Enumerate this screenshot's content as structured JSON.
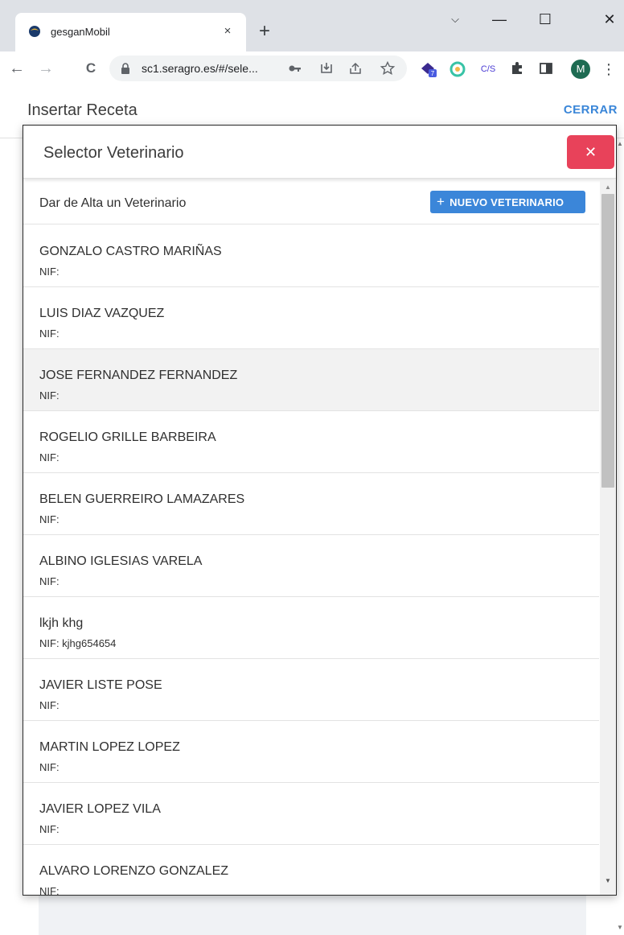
{
  "browser": {
    "tab_title": "gesganMobil",
    "tab_close": "×",
    "new_tab": "+",
    "url": "sc1.seragro.es/#/sele...",
    "back": "←",
    "forward": "→",
    "reload": "C",
    "window_minimize": "—",
    "window_maximize": "☐",
    "window_close": "✕",
    "window_dropdown": "⌵",
    "ext_badge": "7",
    "ext_cs": "C/S",
    "profile_initial": "M",
    "menu": "⋮"
  },
  "app": {
    "title": "Insertar Receta",
    "close_label": "CERRAR"
  },
  "modal": {
    "title": "Selector Veterinario",
    "close_icon": "✕",
    "add_label": "Dar de Alta un Veterinario",
    "new_button_icon": "+",
    "new_button_label": "NUEVO VETERINARIO",
    "veterinarians": [
      {
        "name": "GONZALO CASTRO MARIÑAS",
        "nif": "NIF:"
      },
      {
        "name": "LUIS DIAZ VAZQUEZ",
        "nif": "NIF:"
      },
      {
        "name": "JOSE FERNANDEZ FERNANDEZ",
        "nif": "NIF:",
        "highlighted": true
      },
      {
        "name": "ROGELIO GRILLE BARBEIRA",
        "nif": "NIF:"
      },
      {
        "name": "BELEN GUERREIRO LAMAZARES",
        "nif": "NIF:"
      },
      {
        "name": "ALBINO IGLESIAS VARELA",
        "nif": "NIF:"
      },
      {
        "name": "lkjh khg",
        "nif": "NIF: kjhg654654"
      },
      {
        "name": "JAVIER LISTE POSE",
        "nif": "NIF:"
      },
      {
        "name": "MARTIN LOPEZ LOPEZ",
        "nif": "NIF:"
      },
      {
        "name": "JAVIER LOPEZ VILA",
        "nif": "NIF:"
      },
      {
        "name": "ALVARO LORENZO GONZALEZ",
        "nif": "NIF:"
      }
    ]
  },
  "colors": {
    "accent": "#3b86d9",
    "close_button": "#e8425a",
    "highlight_row": "#f2f2f2"
  }
}
